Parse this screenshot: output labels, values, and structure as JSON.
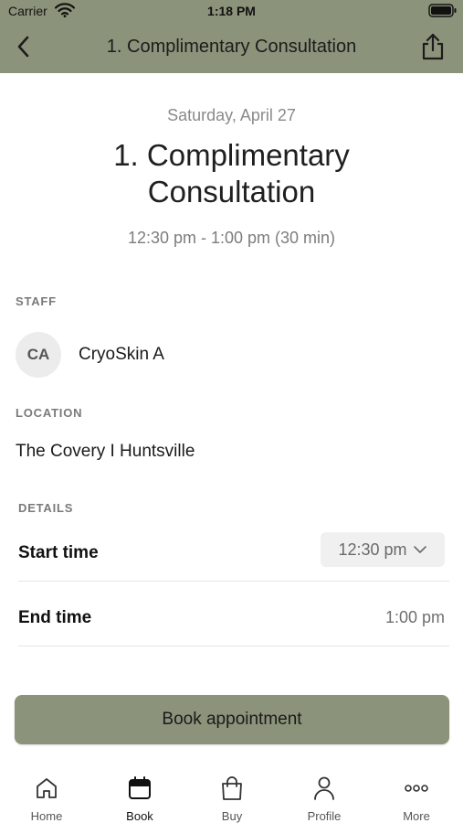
{
  "status_bar": {
    "carrier": "Carrier",
    "time": "1:18 PM"
  },
  "nav": {
    "title": "1. Complimentary Consultation",
    "back_icon": "chevron-left-icon",
    "share_icon": "share-icon"
  },
  "appointment": {
    "date": "Saturday, April 27",
    "title": "1. Complimentary Consultation",
    "time_range": "12:30 pm - 1:00 pm (30 min)"
  },
  "staff": {
    "section_label": "STAFF",
    "initials": "CA",
    "name": "CryoSkin A"
  },
  "location": {
    "section_label": "LOCATION",
    "name": "The Covery I Huntsville"
  },
  "details": {
    "section_label": "DETAILS",
    "start_label": "Start time",
    "start_value": "12:30 pm",
    "end_label": "End time",
    "end_value": "1:00 pm"
  },
  "actions": {
    "book_label": "Book appointment"
  },
  "tabs": [
    {
      "label": "Home",
      "icon": "home-icon",
      "active": false
    },
    {
      "label": "Book",
      "icon": "calendar-icon",
      "active": true
    },
    {
      "label": "Buy",
      "icon": "shopping-bag-icon",
      "active": false
    },
    {
      "label": "Profile",
      "icon": "person-icon",
      "active": false
    },
    {
      "label": "More",
      "icon": "more-icon",
      "active": false
    }
  ],
  "colors": {
    "brand": "#8b937a",
    "text": "#1f1f1f",
    "muted": "#7d7d7d"
  }
}
